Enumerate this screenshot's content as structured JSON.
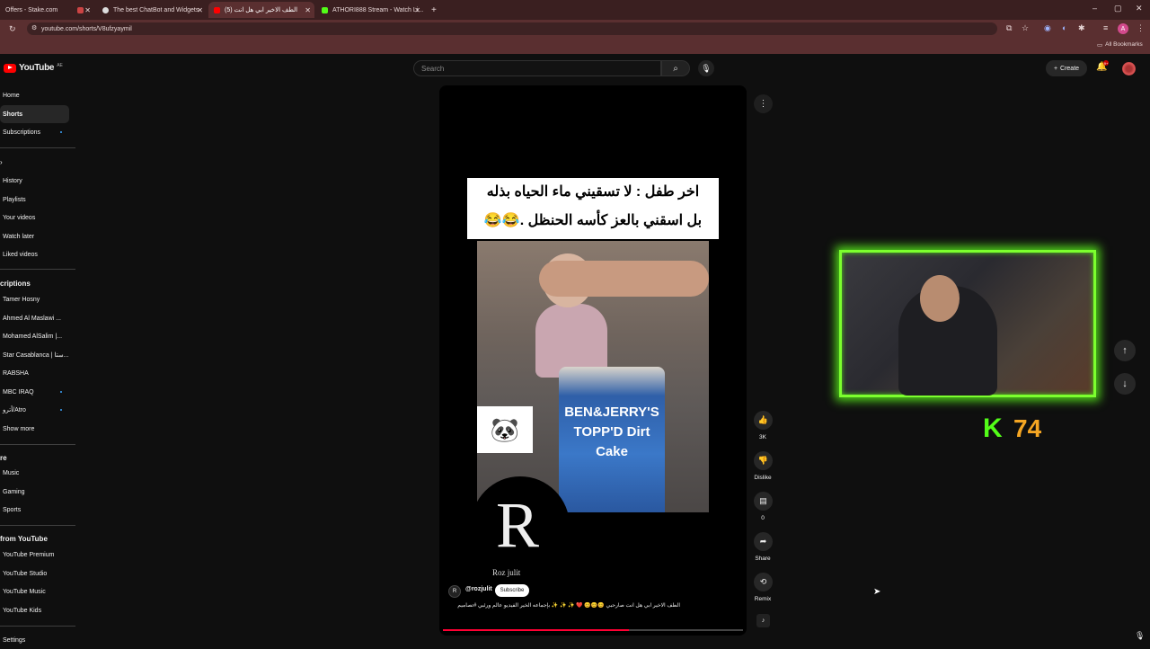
{
  "browser": {
    "tabs": [
      {
        "title": "Offers - Stake.com",
        "active": false
      },
      {
        "title": "",
        "active": false
      },
      {
        "title": "The best ChatBot and Widgets",
        "active": false
      },
      {
        "title": "(5) الطف الاخير ابي هل انت",
        "active": true
      },
      {
        "title": "ATHORI888 Stream - Watch Li...",
        "active": false
      }
    ],
    "new_tab": "+",
    "url": "youtube.com/shorts/V8ufzyaymil",
    "bookmarks_label": "All Bookmarks",
    "window_controls": [
      "–",
      "▢",
      "✕"
    ]
  },
  "youtube": {
    "logo_text": "YouTube",
    "logo_region": "AE",
    "search_placeholder": "Search",
    "create_label": "Create",
    "notification_count": "9+",
    "sidebar": {
      "main": [
        {
          "label": "Home",
          "active": false
        },
        {
          "label": "Shorts",
          "active": true
        },
        {
          "label": "Subscriptions",
          "active": false,
          "dot": true
        }
      ],
      "you_items": [
        "History",
        "Playlists",
        "Your videos",
        "Watch later",
        "Liked videos"
      ],
      "subscriptions_heading": "criptions",
      "subscriptions": [
        {
          "label": "Tamer Hosny",
          "dot": false
        },
        {
          "label": "Ahmed Al Maslawi ...",
          "dot": false
        },
        {
          "label": "Mohamed AlSalim |...",
          "dot": false
        },
        {
          "label": "Star Casablanca | ستا...",
          "dot": false
        },
        {
          "label": "RABSHA",
          "dot": false
        },
        {
          "label": "MBC IRAQ",
          "dot": true
        },
        {
          "label": "أترو/Atro",
          "dot": true
        },
        {
          "label": "Show more",
          "dot": false
        }
      ],
      "explore_heading": "re",
      "explore": [
        "Music",
        "Gaming",
        "Sports"
      ],
      "more_heading": "from YouTube",
      "more_items": [
        "YouTube Premium",
        "YouTube Studio",
        "YouTube Music",
        "YouTube Kids"
      ],
      "settings": "Settings"
    },
    "short": {
      "caption_line1": "اخر طفل : لا تسقيني ماء الحياه بذله",
      "caption_line2": "بل اسقني بالعز كأسه الحنظل .😂😂",
      "tub_text": "BEN&JERRY'S TOPP'D Dirt Cake",
      "watermark_letter": "R",
      "watermark_name": "Roz julit",
      "channel_handle": "@rozjulit",
      "subscribe_label": "Subscribe",
      "description": "الطف الاخير ابي هل انت صارحبي 😊😊😊 ❤️ ✨ ✨ ✨ بإجماعه الخير الفيديو عالم ورئبي #تصاميم",
      "progress": 0.62
    },
    "actions": {
      "like_count": "3K",
      "dislike_label": "Dislike",
      "comment_count": "0",
      "share_label": "Share",
      "remix_label": "Remix"
    }
  },
  "stream_overlay": {
    "kick_letter": "K",
    "viewer_count": "74"
  },
  "colors": {
    "accent_red": "#ff0000",
    "kick_green": "#53fc18",
    "count_orange": "#f5a623",
    "tab_bar": "#3a1f20"
  }
}
